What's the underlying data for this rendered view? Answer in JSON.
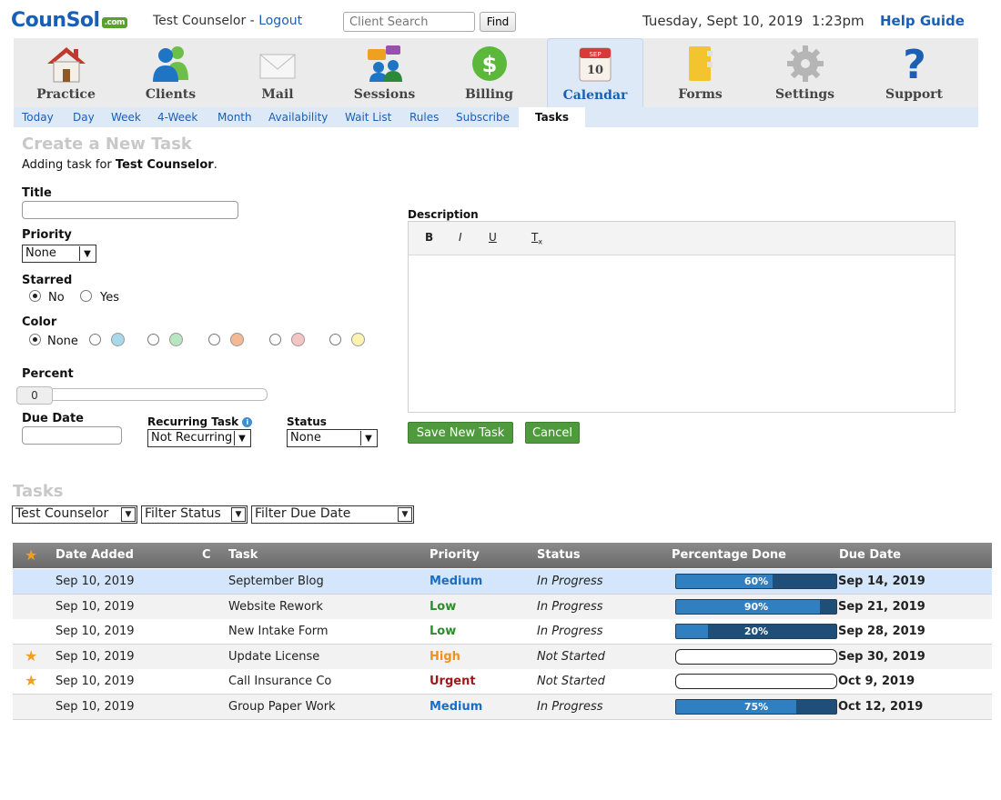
{
  "header": {
    "logo_text": "CounSol",
    "logo_suffix": ".com",
    "user_name": "Test Counselor",
    "separator": " - ",
    "logout_label": "Logout",
    "search_placeholder": "Client Search",
    "find_label": "Find",
    "datetime": "Tuesday, Sept 10, 2019  1:23pm",
    "help_label": "Help Guide"
  },
  "nav": {
    "items": [
      {
        "label": "Practice",
        "icon": "house-icon"
      },
      {
        "label": "Clients",
        "icon": "people-icon"
      },
      {
        "label": "Mail",
        "icon": "envelope-icon"
      },
      {
        "label": "Sessions",
        "icon": "chat-people-icon"
      },
      {
        "label": "Billing",
        "icon": "dollar-icon"
      },
      {
        "label": "Calendar",
        "icon": "calendar-icon",
        "active": true
      },
      {
        "label": "Forms",
        "icon": "folder-icon"
      },
      {
        "label": "Settings",
        "icon": "gear-icon"
      },
      {
        "label": "Support",
        "icon": "question-icon"
      }
    ],
    "calendar_icon_month": "SEP",
    "calendar_icon_day": "10"
  },
  "subnav": {
    "items": [
      "Today",
      "Day",
      "Week",
      "4-Week",
      "Month",
      "Availability",
      "Wait List",
      "Rules",
      "Subscribe"
    ],
    "active": "Tasks"
  },
  "form": {
    "title": "Create a New Task",
    "adding_prefix": "Adding task for ",
    "adding_user": "Test Counselor",
    "adding_suffix": ".",
    "title_label": "Title",
    "title_value": "",
    "priority_label": "Priority",
    "priority_value": "None",
    "starred_label": "Starred",
    "starred_no": "No",
    "starred_yes": "Yes",
    "color_label": "Color",
    "color_none": "None",
    "colors": [
      "#a8d8ea",
      "#b8e6c1",
      "#f5b895",
      "#f5c4c4",
      "#fdf3b0"
    ],
    "percent_label": "Percent",
    "percent_value": "0",
    "due_label": "Due Date",
    "due_value": "",
    "recurring_label": "Recurring Task",
    "recurring_value": "Not Recurring",
    "status_label": "Status",
    "status_value": "None",
    "description_label": "Description",
    "toolbar": {
      "bold": "B",
      "italic": "I",
      "underline": "U",
      "clear": "T"
    },
    "save_label": "Save New Task",
    "cancel_label": "Cancel"
  },
  "tasks": {
    "title": "Tasks",
    "filters": {
      "counselor": "Test Counselor",
      "status": "Filter Status",
      "due": "Filter Due Date"
    },
    "columns": {
      "date_added": "Date Added",
      "color": "C",
      "task": "Task",
      "priority": "Priority",
      "status": "Status",
      "percent": "Percentage Done",
      "due": "Due Date"
    },
    "rows": [
      {
        "starred": false,
        "date_added": "Sep 10, 2019",
        "task": "September Blog",
        "priority": "Medium",
        "priority_color": "#1a6fc4",
        "status": "In Progress",
        "percent": 60,
        "percent_label": "60%",
        "due": "Sep 14, 2019",
        "highlight": true
      },
      {
        "starred": false,
        "date_added": "Sep 10, 2019",
        "task": "Website Rework",
        "priority": "Low",
        "priority_color": "#2e8b2e",
        "status": "In Progress",
        "percent": 90,
        "percent_label": "90%",
        "due": "Sep 21, 2019",
        "shade": true
      },
      {
        "starred": false,
        "date_added": "Sep 10, 2019",
        "task": "New Intake Form",
        "priority": "Low",
        "priority_color": "#2e8b2e",
        "status": "In Progress",
        "percent": 20,
        "percent_label": "20%",
        "due": "Sep 28, 2019"
      },
      {
        "starred": true,
        "date_added": "Sep 10, 2019",
        "task": "Update License",
        "priority": "High",
        "priority_color": "#f0901e",
        "status": "Not Started",
        "percent": 0,
        "percent_label": "",
        "due": "Sep 30, 2019",
        "shade": true
      },
      {
        "starred": true,
        "date_added": "Sep 10, 2019",
        "task": "Call Insurance Co",
        "priority": "Urgent",
        "priority_color": "#a01818",
        "status": "Not Started",
        "percent": 0,
        "percent_label": "",
        "due": "Oct 9, 2019"
      },
      {
        "starred": false,
        "date_added": "Sep 10, 2019",
        "task": "Group Paper Work",
        "priority": "Medium",
        "priority_color": "#1a6fc4",
        "status": "In Progress",
        "percent": 75,
        "percent_label": "75%",
        "due": "Oct 12, 2019",
        "shade": true
      }
    ]
  }
}
